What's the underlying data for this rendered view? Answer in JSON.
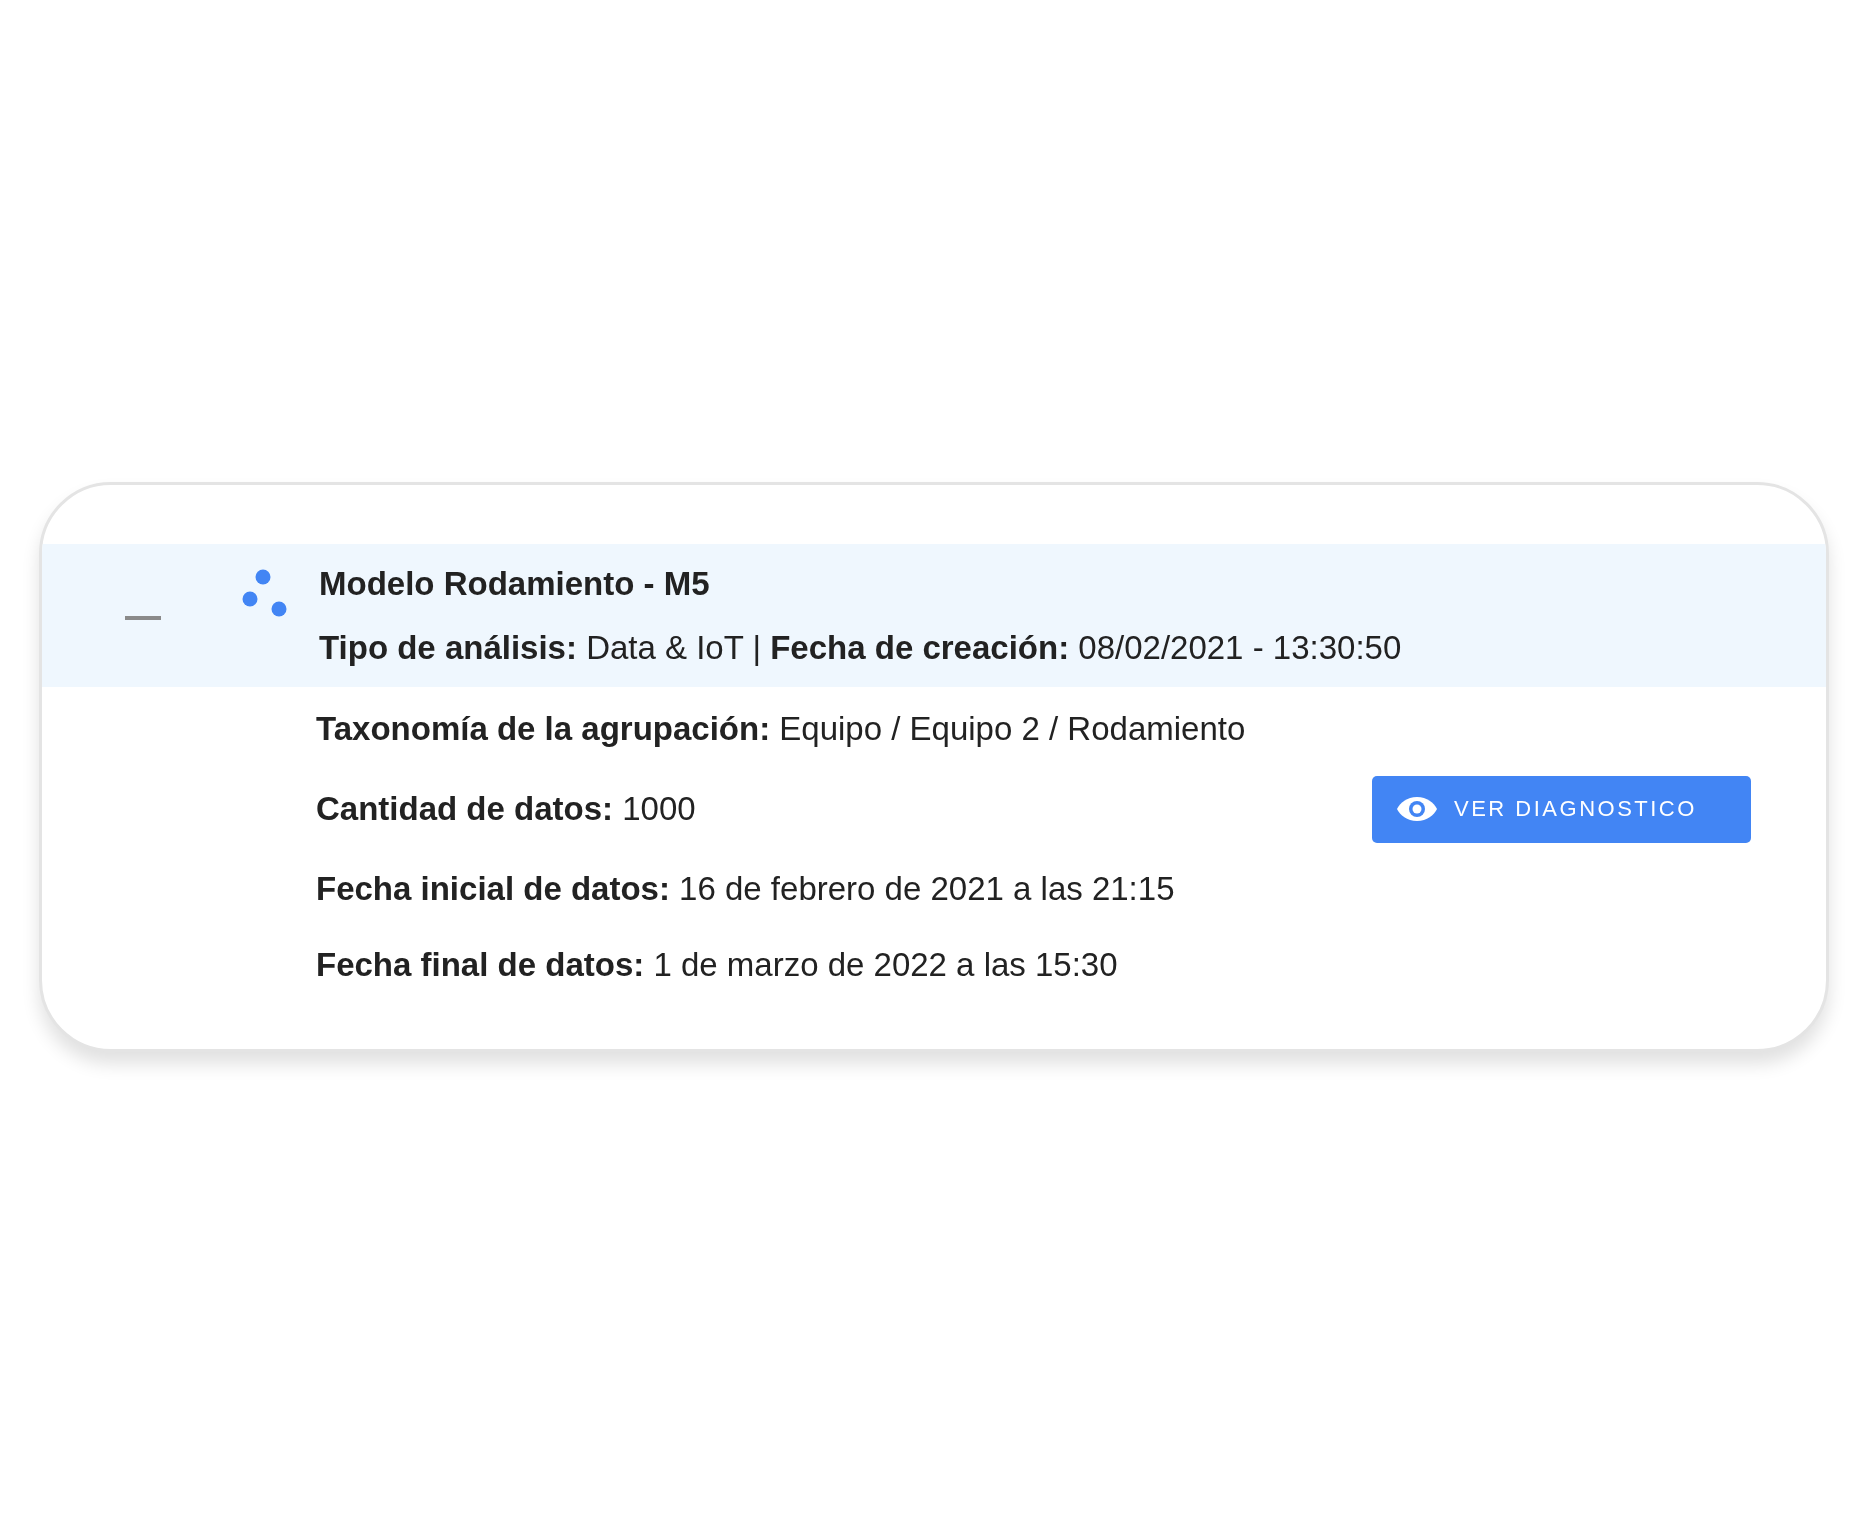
{
  "model": {
    "expanded": true,
    "title": "Modelo Rodamiento - M5",
    "summary": "**Tipo de análisis:** Data & IoT | **Fecha de creación:** 08/02/2021 - 13:30:50",
    "details": [
      {
        "text": "**Taxonomía de la agrupación:** Equipo / Equipo 2 / Rodamiento"
      },
      {
        "text": "**Cantidad de datos:** 1000",
        "button": "VER DIAGNOSTICO"
      },
      {
        "text": "**Fecha inicial de datos:** 16 de febrero de 2021 a las 21:15"
      },
      {
        "text": "**Fecha final de datos:** 1 de marzo de 2022 a las 15:30"
      }
    ]
  }
}
